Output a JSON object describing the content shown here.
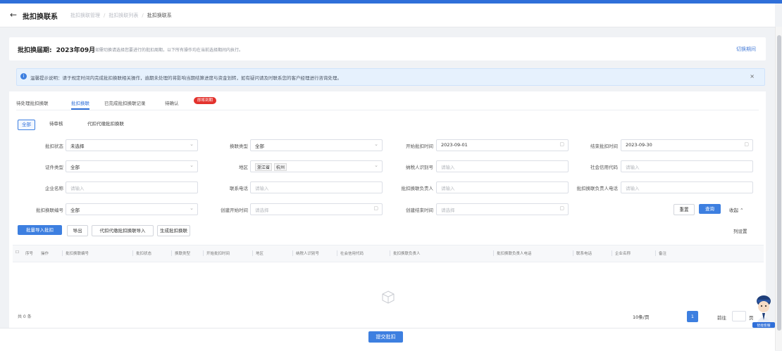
{
  "header": {
    "back_icon": "arrow-left-icon",
    "title": "批扣换联系",
    "breadcrumb": [
      "批扣换联管理",
      "批扣换联列表",
      "批扣换联系"
    ]
  },
  "period_card": {
    "label": "批扣换届期:",
    "date": "2023年09月",
    "description": "如需切换请选择您要进行的批扣周期，以下所有操作均在当前选择期间内执行。",
    "link": "切换期间"
  },
  "notice": {
    "icon": "info-icon",
    "text": "温馨提示说明：请于规定时间内完成批扣换联相关操作，逾期未处理的将影响当期结算进度与资金划转，如有疑问请及时联系您的客户经理进行咨询处理。",
    "close": "×"
  },
  "tabs": {
    "items": [
      "待处理批扣换联",
      "批扣换联",
      "已完成批扣换联记录",
      "待确认"
    ],
    "active": 1,
    "badge": "即将到期"
  },
  "subtabs": {
    "items": [
      "全部",
      "待审核",
      "代扣代缴批扣换联"
    ],
    "active": 0
  },
  "filters": {
    "row1": [
      {
        "label": "批扣状态",
        "value": "未选择",
        "placeholder": false,
        "suffix": "⌄"
      },
      {
        "label": "换联类型",
        "value": "全部",
        "placeholder": false,
        "suffix": "⌄"
      },
      {
        "label": "开始批扣时间",
        "value": "2023-09-01",
        "placeholder": false,
        "suffix": "▢"
      },
      {
        "label": "结束批扣时间",
        "value": "2023-09-30",
        "placeholder": false,
        "suffix": "▢"
      }
    ],
    "row2": [
      {
        "label": "证件类型",
        "value": "全部",
        "placeholder": false,
        "suffix": "⌄"
      },
      {
        "label": "地区",
        "value": "",
        "tags": [
          "浙江省",
          "杭州"
        ],
        "placeholder": false,
        "suffix": "⌄"
      },
      {
        "label": "纳税人识别号",
        "value": "请输入",
        "placeholder": true,
        "suffix": ""
      },
      {
        "label": "社会信用代码",
        "value": "请输入",
        "placeholder": true,
        "suffix": ""
      }
    ],
    "row3": [
      {
        "label": "企业名称",
        "value": "请输入",
        "placeholder": true,
        "suffix": ""
      },
      {
        "label": "联系电话",
        "value": "请输入",
        "placeholder": true,
        "suffix": ""
      },
      {
        "label": "批扣换联负责人",
        "value": "请输入",
        "placeholder": true,
        "suffix": ""
      },
      {
        "label": "批扣换联负责人电话",
        "value": "请输入",
        "placeholder": true,
        "suffix": ""
      }
    ],
    "row4": [
      {
        "label": "批扣换联编号",
        "value": "全部",
        "placeholder": false,
        "suffix": "⌄"
      },
      {
        "label": "创建开始时间",
        "value": "请选择",
        "placeholder": true,
        "suffix": "▢"
      },
      {
        "label": "创建结束时间",
        "value": "请选择",
        "placeholder": true,
        "suffix": "▢"
      }
    ],
    "reset": "重置",
    "search": "查询",
    "collapse": "收起 ⌃"
  },
  "actions": {
    "primary": "批量导入批扣",
    "export": "导出",
    "import_agent": "代扣代缴批扣换联导入",
    "generate": "生成批扣换联",
    "right": "列设置"
  },
  "table": {
    "checkbox": "☐",
    "columns": [
      "序号",
      "操作",
      "批扣换联编号",
      "批扣状态",
      "换联类型",
      "开始批扣时间",
      "地区",
      "纳税人识别号",
      "社会信用代码",
      "批扣换联负责人",
      "批扣换联负责人电话",
      "联系电话",
      "企业名称",
      "备注"
    ],
    "empty_icon": "empty-box-icon"
  },
  "pagination": {
    "total": "共 0 条",
    "page_size": "10条/页",
    "current": "1",
    "goto": "前往",
    "page_unit": "页"
  },
  "footer": {
    "submit": "提交批扣"
  },
  "assistant": {
    "icon": "assistant-avatar-icon",
    "label": "智能客服"
  }
}
